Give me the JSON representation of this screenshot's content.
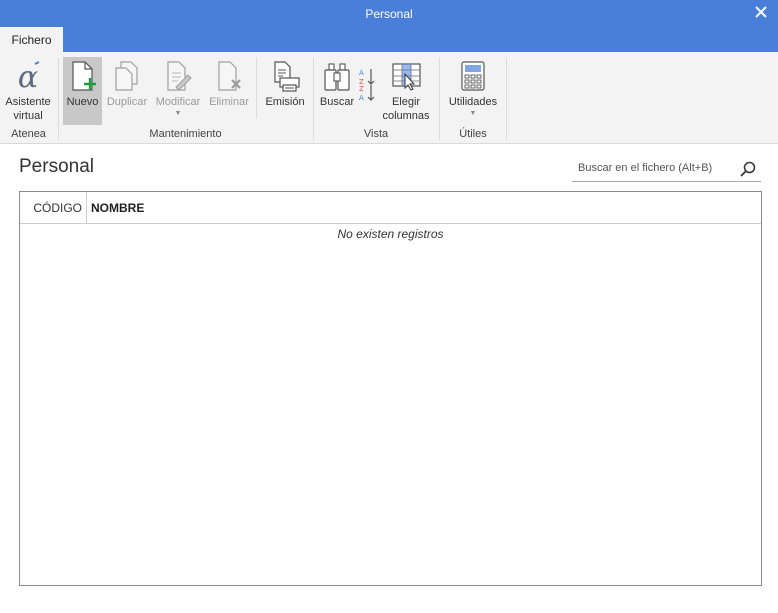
{
  "window": {
    "title": "Personal"
  },
  "tabs": [
    {
      "label": "Fichero"
    }
  ],
  "ribbon": {
    "groups": [
      {
        "label": "Atenea",
        "buttons": [
          {
            "label": "Asistente virtual"
          }
        ]
      },
      {
        "label": "Mantenimiento",
        "buttons": [
          {
            "label": "Nuevo"
          },
          {
            "label": "Duplicar"
          },
          {
            "label": "Modificar"
          },
          {
            "label": "Eliminar"
          },
          {
            "label": "Emisión"
          }
        ]
      },
      {
        "label": "Vista",
        "buttons": [
          {
            "label": "Buscar"
          },
          {
            "label": "Elegir columnas"
          }
        ]
      },
      {
        "label": "Útiles",
        "buttons": [
          {
            "label": "Utilidades"
          }
        ]
      }
    ]
  },
  "content": {
    "title": "Personal",
    "search_placeholder": "Buscar en el fichero (Alt+B)",
    "columns": [
      "CÓDIGO",
      "NOMBRE"
    ],
    "empty_message": "No existen registros"
  }
}
